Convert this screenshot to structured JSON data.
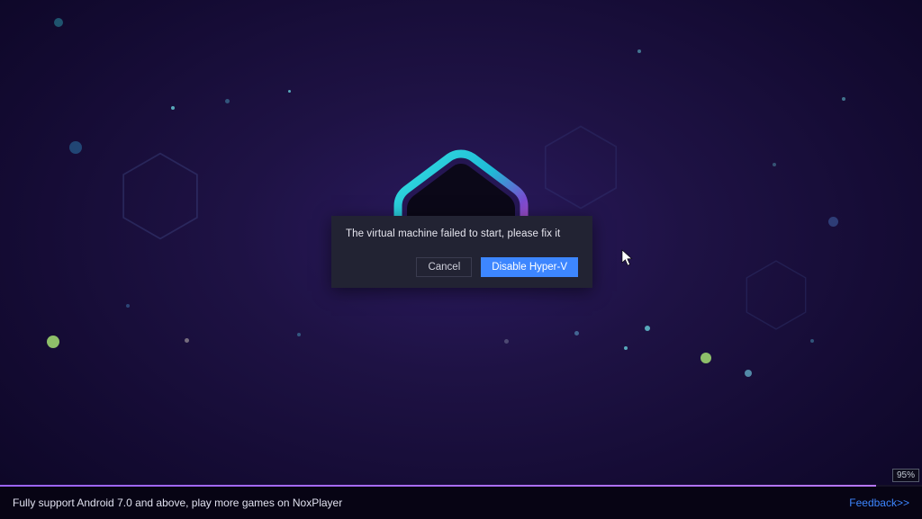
{
  "dialog": {
    "message": "The virtual machine failed to start, please fix it",
    "cancel_label": "Cancel",
    "primary_label": "Disable Hyper-V"
  },
  "footer": {
    "message": "Fully support Android 7.0 and above, play more games on NoxPlayer",
    "feedback_label": "Feedback>>"
  },
  "progress": {
    "percent": 95,
    "percent_label": "95%"
  },
  "colors": {
    "accent": "#3d86ff",
    "progress": "#a96eff"
  }
}
